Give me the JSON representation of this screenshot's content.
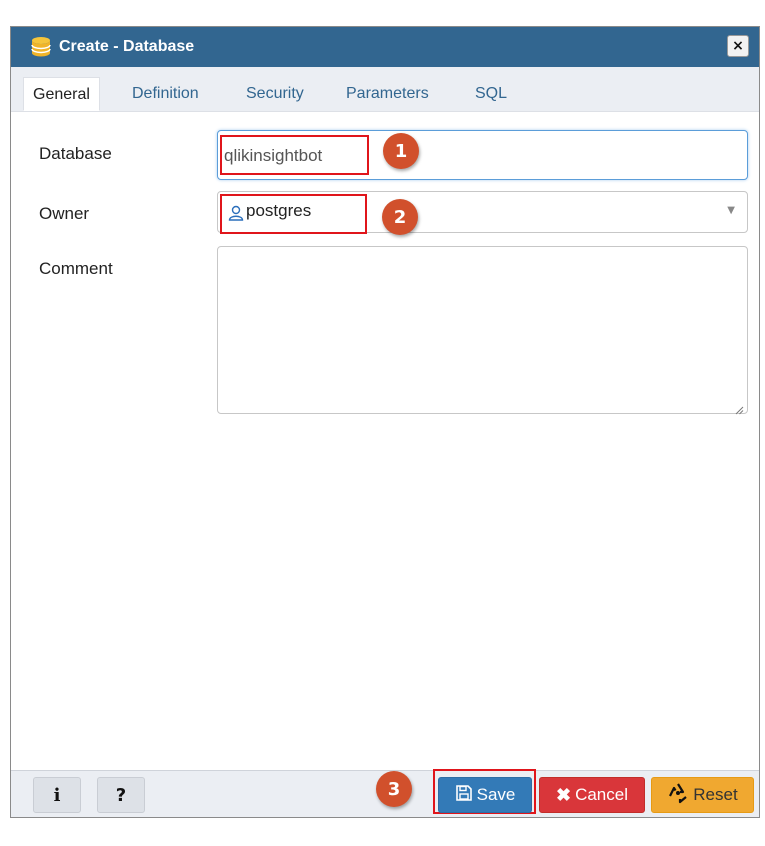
{
  "dialog": {
    "title": "Create - Database",
    "close_label": "×",
    "header_color": "#326690"
  },
  "tabs": [
    {
      "label": "General",
      "active": true
    },
    {
      "label": "Definition",
      "active": false
    },
    {
      "label": "Security",
      "active": false
    },
    {
      "label": "Parameters",
      "active": false
    },
    {
      "label": "SQL",
      "active": false
    }
  ],
  "form": {
    "database_label": "Database",
    "database_value": "qlikinsightbot",
    "owner_label": "Owner",
    "owner_value": "postgres",
    "comment_label": "Comment",
    "comment_value": ""
  },
  "markers": [
    "1",
    "2",
    "3"
  ],
  "footer": {
    "info_label": "i",
    "help_label": "?",
    "save_label": "Save",
    "cancel_label": "Cancel",
    "reset_label": "Reset"
  },
  "colors": {
    "save": "#337ab7",
    "cancel": "#d9363a",
    "reset": "#f0a830",
    "marker": "#d1502c",
    "highlight": "#e0151b"
  },
  "icons": [
    "database-icon",
    "user-icon",
    "save-icon",
    "cancel-x-icon",
    "recycle-icon",
    "dropdown-arrow-icon",
    "resize-handle-icon"
  ]
}
